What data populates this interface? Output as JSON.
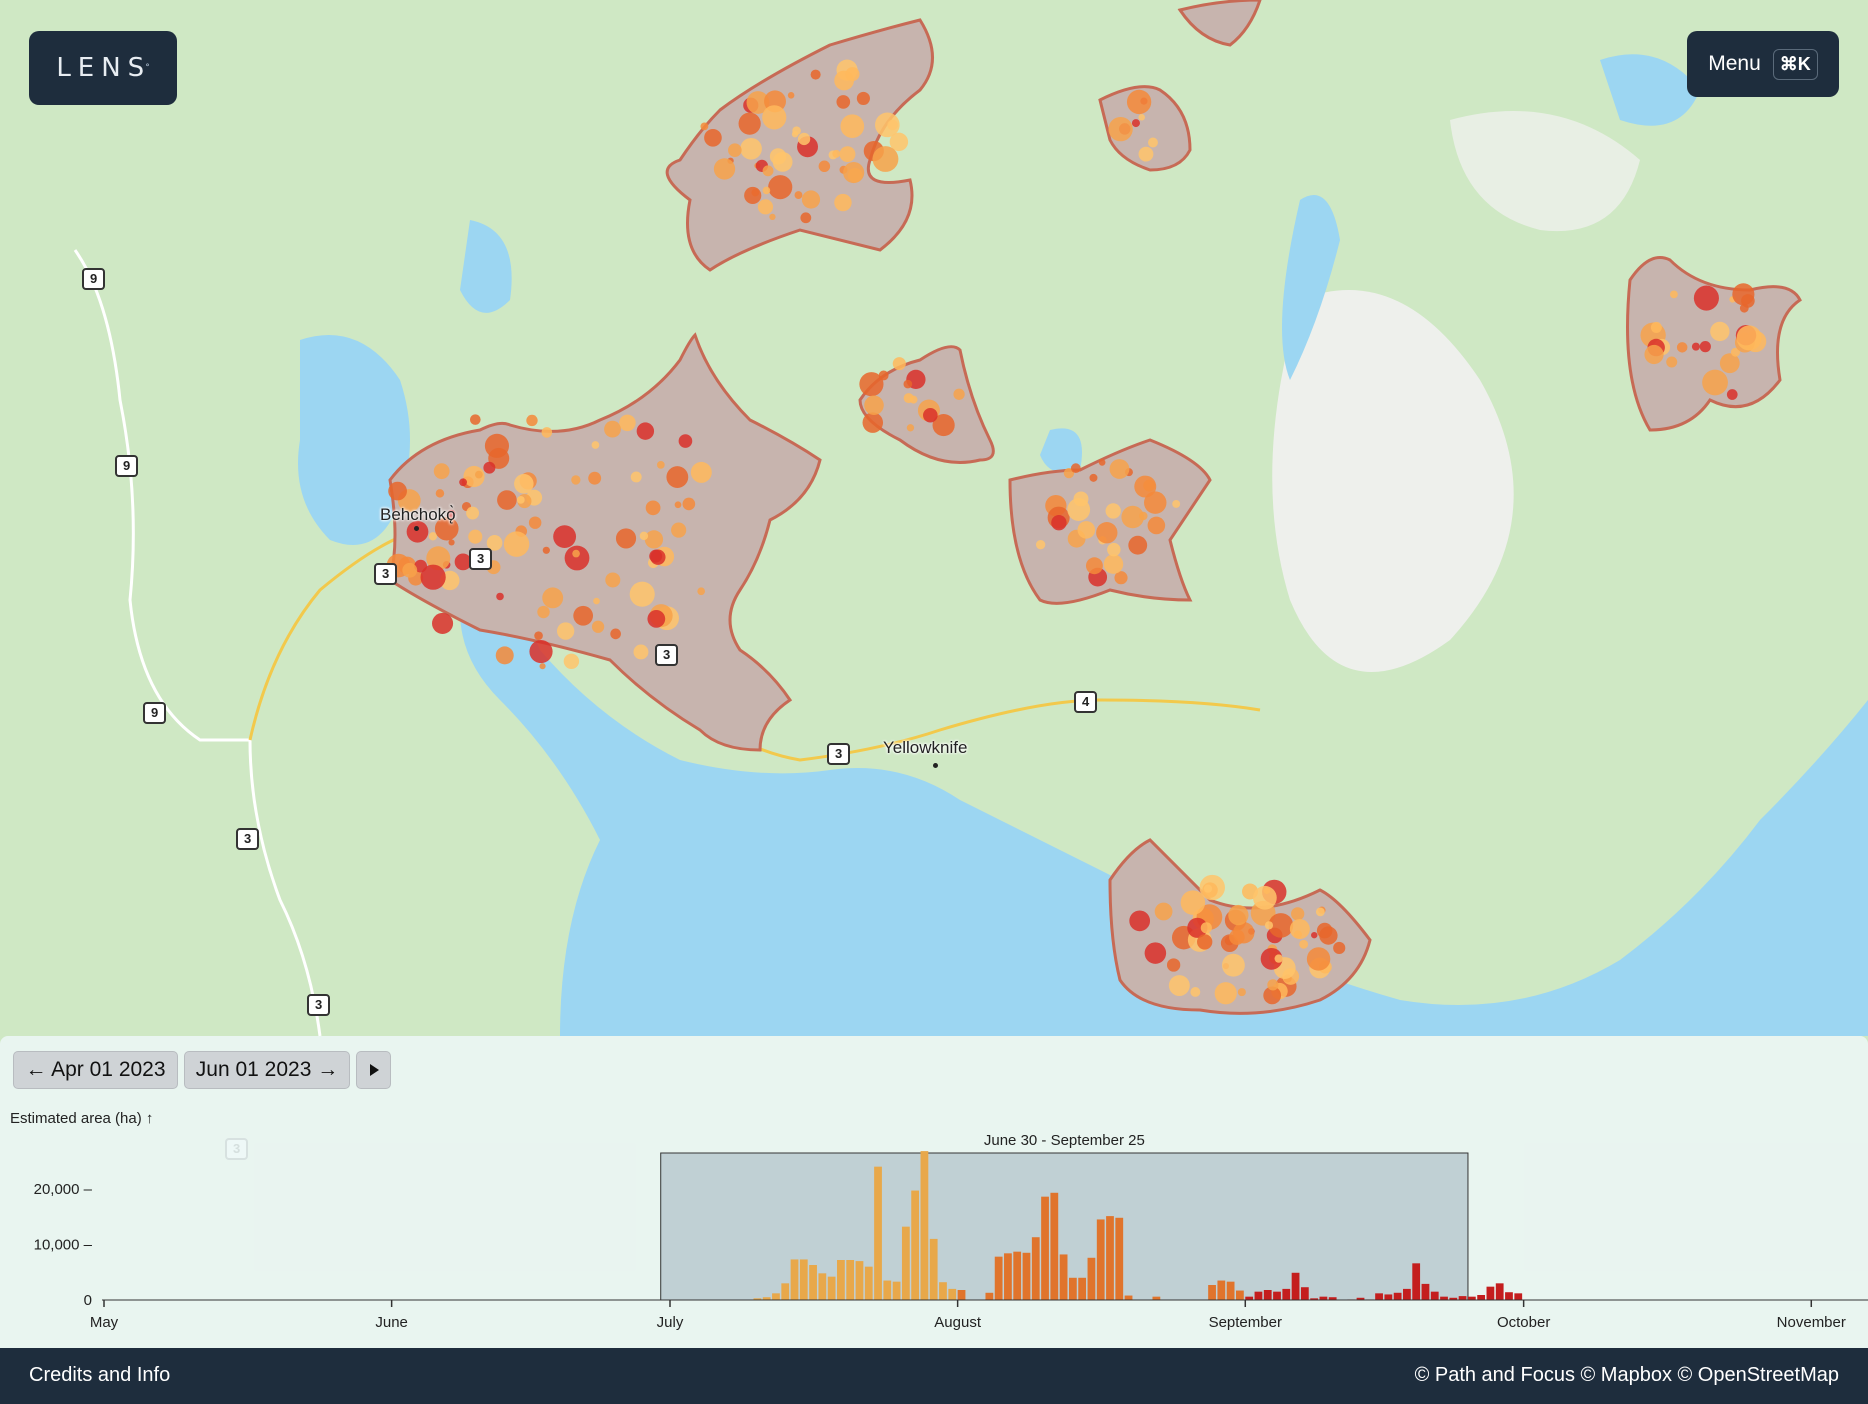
{
  "app": {
    "logo_text": "LENS",
    "logo_mark": "°"
  },
  "menu": {
    "label": "Menu",
    "shortcut": "⌘K"
  },
  "map": {
    "places": [
      {
        "name": "Behchokǫ̀"
      },
      {
        "name": "Yellowknife"
      }
    ],
    "route_shields": [
      "9",
      "9",
      "9",
      "3",
      "3",
      "3",
      "3",
      "3",
      "3",
      "4",
      "3"
    ],
    "colors": {
      "land": "#cfe8c4",
      "water": "#9cd6f2",
      "burn_area": "#c7b4ae",
      "burn_outline": "#c76a55"
    }
  },
  "timeline": {
    "prev_button": "← Apr 01 2023",
    "next_button": "Jun 01 2023 →",
    "play_icon": "play-icon",
    "y_axis_label": "Estimated area (ha) ↑",
    "selection_label": "June 30 - September 25"
  },
  "chart_data": {
    "type": "bar",
    "ylabel": "Estimated area (ha)",
    "ylim": [
      0,
      27000
    ],
    "yticks": [
      {
        "value": 20000,
        "label": "20,000 –"
      },
      {
        "value": 10000,
        "label": "10,000 –"
      },
      {
        "value": 0,
        "label": "0"
      }
    ],
    "x_months": [
      "May",
      "June",
      "July",
      "August",
      "September",
      "October",
      "November"
    ],
    "x_start_day": 121,
    "x_day_month_starts": [
      121,
      152,
      182,
      213,
      244,
      274,
      305
    ],
    "selection_days": [
      181,
      268
    ],
    "values": [
      0,
      0,
      0,
      0,
      0,
      0,
      0,
      0,
      0,
      0,
      300,
      500,
      1200,
      3000,
      7300,
      7300,
      6300,
      4800,
      4200,
      7200,
      7200,
      7000,
      6000,
      24000,
      3500,
      3300,
      13200,
      19700,
      26800,
      11000,
      3200,
      2000,
      1800,
      0,
      0,
      1300,
      7800,
      8400,
      8700,
      8500,
      11300,
      18600,
      19300,
      8200,
      4000,
      4000,
      7600,
      14500,
      15100,
      14800,
      800,
      0,
      0,
      600,
      0,
      0,
      0,
      0,
      0,
      2700,
      3500,
      3300,
      1700,
      600,
      1500,
      1800,
      1500,
      2000,
      4900,
      2300,
      300,
      600,
      500,
      0,
      100,
      400,
      100,
      1200,
      1000,
      1300,
      2000,
      6600,
      2900,
      1500,
      600,
      400,
      700,
      600,
      900,
      2400,
      3000,
      1400,
      1200
    ]
  },
  "footer": {
    "credits_label": "Credits and Info",
    "attribution": "© Path and Focus © Mapbox © OpenStreetMap"
  }
}
